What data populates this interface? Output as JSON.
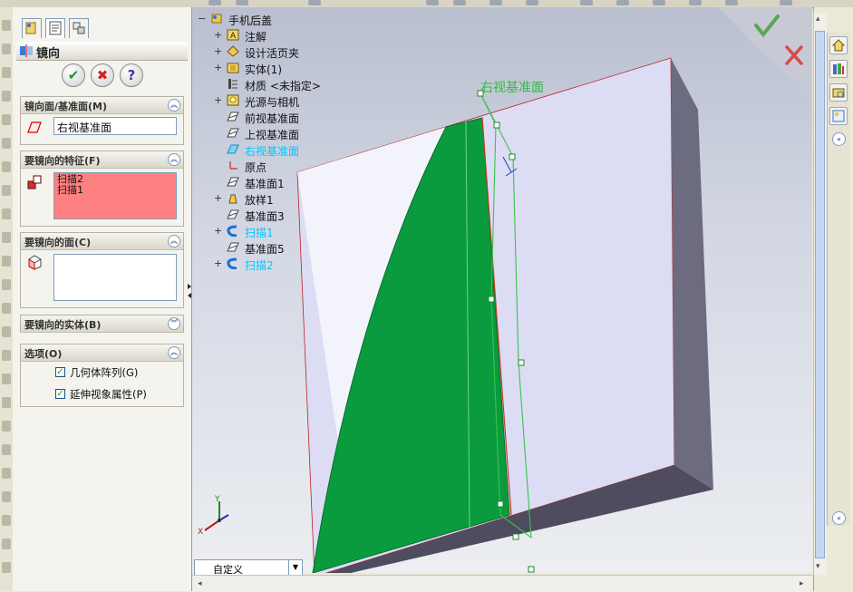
{
  "property_manager": {
    "title": "镜向",
    "ok_label": "✔",
    "cancel_label": "✖",
    "help_label": "?",
    "groups": {
      "mirror_plane": {
        "header": "镜向面/基准面(M)",
        "value": "右视基准面"
      },
      "features": {
        "header": "要镜向的特征(F)",
        "items": [
          "扫描2",
          "扫描1"
        ]
      },
      "faces": {
        "header": "要镜向的面(C)"
      },
      "bodies": {
        "header": "要镜向的实体(B)"
      },
      "options": {
        "header": "选项(O)",
        "checkbox1": "几何体阵列(G)",
        "checkbox2": "延伸视象属性(P)",
        "checkbox1_checked": true,
        "checkbox2_checked": true
      }
    }
  },
  "feature_tree": {
    "root": "手机后盖",
    "items": [
      {
        "label": "注解",
        "expandable": true
      },
      {
        "label": "设计活页夹",
        "expandable": true
      },
      {
        "label": "实体(1)",
        "expandable": true
      },
      {
        "label": "材质 <未指定>",
        "expandable": false
      },
      {
        "label": "光源与相机",
        "expandable": true
      },
      {
        "label": "前视基准面",
        "expandable": false
      },
      {
        "label": "上视基准面",
        "expandable": false
      },
      {
        "label": "右视基准面",
        "expandable": false,
        "highlight": true
      },
      {
        "label": "原点",
        "expandable": false
      },
      {
        "label": "基准面1",
        "expandable": false
      },
      {
        "label": "放样1",
        "expandable": true
      },
      {
        "label": "基准面3",
        "expandable": false
      },
      {
        "label": "扫描1",
        "expandable": true,
        "highlight": true
      },
      {
        "label": "基准面5",
        "expandable": false
      },
      {
        "label": "扫描2",
        "expandable": true,
        "highlight": true
      }
    ]
  },
  "viewport": {
    "plane_label": "右视基准面",
    "view_combo": "自定义",
    "axis_y": "Y",
    "axis_x": "X"
  },
  "colors": {
    "green_face": "#0a9b3f",
    "plane_label": "#2ebd3c",
    "highlight": "#00c8ff",
    "part_face": "#dcdcf4",
    "part_side": "#5e5c70"
  }
}
